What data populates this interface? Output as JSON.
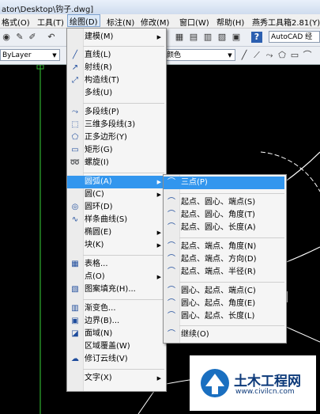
{
  "titlebar": {
    "path": "ator\\Desktop\\钩子.dwg]"
  },
  "menubar": {
    "format": "格式(O)",
    "tools": "工具(T)",
    "draw": "绘图(D)",
    "dimension": "标注(N)",
    "modify": "修改(M)",
    "window": "窗口(W)",
    "help": "帮助(H)",
    "yanxiu": "燕秀工具箱2.81(Y)"
  },
  "toolbar": {
    "workspace": "AutoCAD 经",
    "layer": "ByLayer",
    "color": "颜色"
  },
  "draw_menu": [
    {
      "label": "建模(M)",
      "icon": "",
      "sub": true
    },
    {
      "label": "直线(L)",
      "icon": "line-icon"
    },
    {
      "label": "射线(R)",
      "icon": "ray-icon"
    },
    {
      "label": "构造线(T)",
      "icon": "xline-icon"
    },
    {
      "label": "多线(U)",
      "icon": ""
    },
    {
      "label": "多段线(P)",
      "icon": "polyline-icon"
    },
    {
      "label": "三维多段线(3)",
      "icon": "3d-polyline-icon"
    },
    {
      "label": "正多边形(Y)",
      "icon": "polygon-icon"
    },
    {
      "label": "矩形(G)",
      "icon": "rectangle-icon"
    },
    {
      "label": "螺旋(I)",
      "icon": "helix-icon"
    },
    {
      "label": "圆弧(A)",
      "icon": "",
      "sub": true
    },
    {
      "label": "圆(C)",
      "icon": "",
      "sub": true
    },
    {
      "label": "圆环(D)",
      "icon": "donut-icon"
    },
    {
      "label": "样条曲线(S)",
      "icon": "spline-icon"
    },
    {
      "label": "椭圆(E)",
      "icon": "",
      "sub": true
    },
    {
      "label": "块(K)",
      "icon": "",
      "sub": true
    },
    {
      "label": "表格...",
      "icon": "table-icon"
    },
    {
      "label": "点(O)",
      "icon": "",
      "sub": true
    },
    {
      "label": "图案填充(H)...",
      "icon": "hatch-icon"
    },
    {
      "label": "渐变色...",
      "icon": "gradient-icon"
    },
    {
      "label": "边界(B)...",
      "icon": "boundary-icon"
    },
    {
      "label": "面域(N)",
      "icon": "region-icon"
    },
    {
      "label": "区域覆盖(W)",
      "icon": ""
    },
    {
      "label": "修订云线(V)",
      "icon": "revcloud-icon"
    },
    {
      "label": "文字(X)",
      "icon": "",
      "sub": true
    }
  ],
  "arc_menu": [
    "三点(P)",
    "起点、圆心、端点(S)",
    "起点、圆心、角度(T)",
    "起点、圆心、长度(A)",
    "起点、端点、角度(N)",
    "起点、端点、方向(D)",
    "起点、端点、半径(R)",
    "圆心、起点、端点(C)",
    "圆心、起点、角度(E)",
    "圆心、起点、长度(L)",
    "继续(O)"
  ],
  "watermark": {
    "brand": "土木工程网",
    "url": "www.civilcn.com"
  },
  "colors": {
    "highlight": "#3296ee",
    "drawing_green": "#2fae2f"
  }
}
